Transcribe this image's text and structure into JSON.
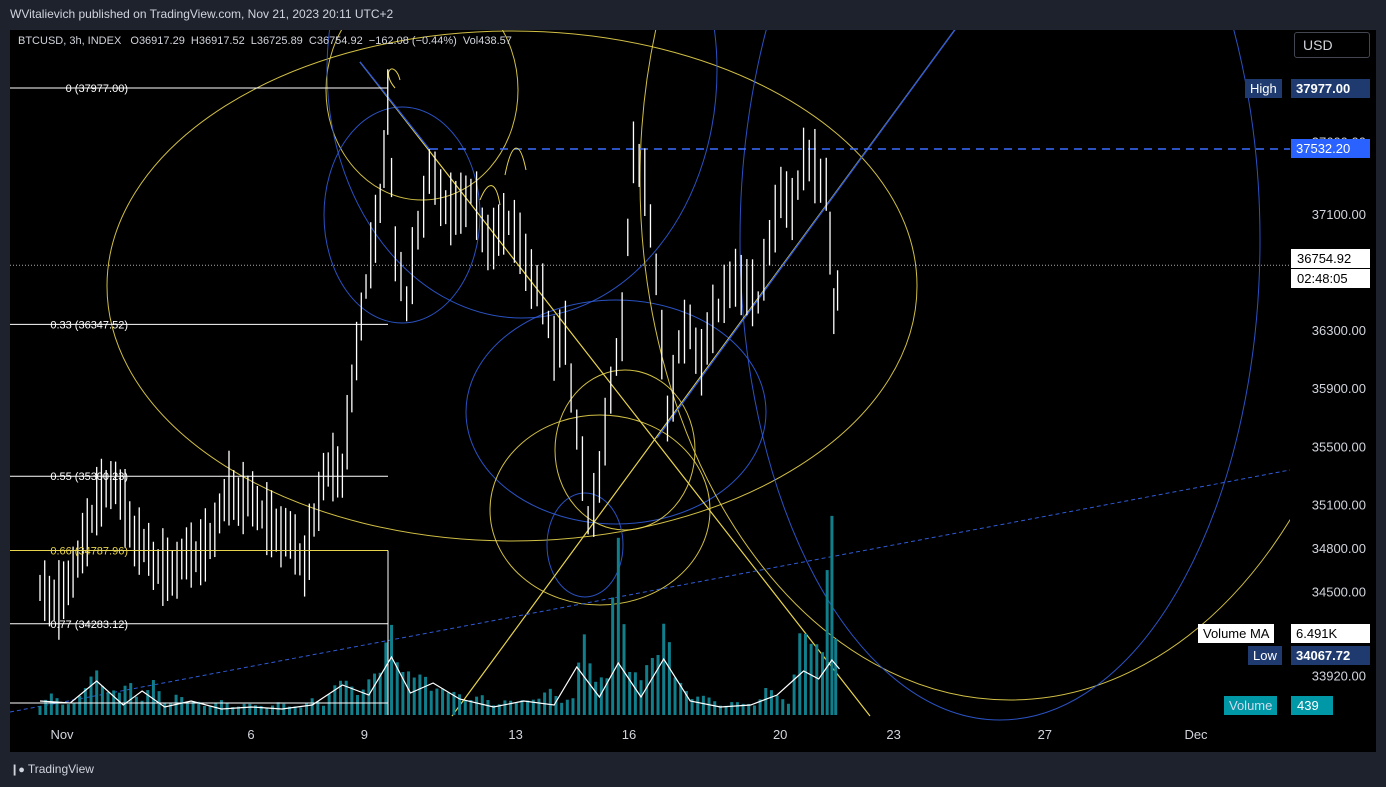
{
  "header": {
    "publisher": "WVitalievich published on TradingView.com, Nov 21, 2023 20:11 UTC+2",
    "currency_button": "USD",
    "brand": "TradingView"
  },
  "legend": {
    "symbol": "BTCUSD, 3h, INDEX",
    "open_label": "O",
    "open": "36917.29",
    "high_label": "H",
    "high": "36917.52",
    "low_label": "L",
    "low": "36725.89",
    "close_label": "C",
    "close": "36754.92",
    "change": "−162.08 (−0.44%)",
    "vol_label": "Vol",
    "vol": "438.57"
  },
  "price_badges": {
    "high_label": "High",
    "high_value": "37977.00",
    "level_value": "37532.20",
    "last_price": "36754.92",
    "countdown": "02:48:05",
    "vma_label": "Volume MA",
    "vma_value": "6.491K",
    "low_label": "Low",
    "low_value": "34067.72",
    "volume_label": "Volume",
    "volume_value": "439"
  },
  "colors": {
    "background": "#000000",
    "candle": "#ffffff",
    "fib_yellow": "#e8d44d",
    "fib_blue": "#2f5bd6",
    "volume": "#117e8c",
    "level_line": "#3b6cff"
  },
  "chart_data": {
    "type": "bar",
    "title": "",
    "xlabel": "",
    "ylabel": "",
    "ylim": [
      33700,
      38650
    ],
    "x_ticks": [
      {
        "label": "Nov",
        "day": 0
      },
      {
        "label": "6",
        "day": 5
      },
      {
        "label": "9",
        "day": 8
      },
      {
        "label": "13",
        "day": 12
      },
      {
        "label": "16",
        "day": 15
      },
      {
        "label": "20",
        "day": 19
      },
      {
        "label": "23",
        "day": 22
      },
      {
        "label": "27",
        "day": 26
      },
      {
        "label": "Dec",
        "day": 30
      }
    ],
    "y_ticks": [
      {
        "label": "37600.00",
        "value": 37600
      },
      {
        "label": "37100.00",
        "value": 37100
      },
      {
        "label": "36300.00",
        "value": 36300
      },
      {
        "label": "35900.00",
        "value": 35900
      },
      {
        "label": "35500.00",
        "value": 35500
      },
      {
        "label": "35100.00",
        "value": 35100
      },
      {
        "label": "34800.00",
        "value": 34800
      },
      {
        "label": "34500.00",
        "value": 34500
      },
      {
        "label": "33920.00",
        "value": 33920
      }
    ],
    "fib_levels": [
      {
        "label": "0 (37977.00)",
        "value": 37977
      },
      {
        "label": "0.33 (36347.52)",
        "value": 36347.52
      },
      {
        "label": "0.55 (35300.23)",
        "value": 35300.23
      },
      {
        "label": "0.66 (34787.96)",
        "value": 34787.96,
        "highlight": true
      },
      {
        "label": "0.77 (34283.12)",
        "value": 34283.12
      }
    ],
    "horizontal_level": 37532.2,
    "last_price": 36754.92,
    "price_path": [
      [
        0.0,
        34500
      ],
      [
        0.5,
        34450
      ],
      [
        1.0,
        34700
      ],
      [
        1.5,
        35150
      ],
      [
        2.0,
        35250
      ],
      [
        2.5,
        34900
      ],
      [
        3.0,
        34700
      ],
      [
        3.5,
        34650
      ],
      [
        4.0,
        34750
      ],
      [
        4.5,
        34850
      ],
      [
        5.0,
        35200
      ],
      [
        5.5,
        35150
      ],
      [
        6.0,
        35000
      ],
      [
        6.5,
        34900
      ],
      [
        7.0,
        34700
      ],
      [
        7.5,
        35300
      ],
      [
        8.0,
        35350
      ],
      [
        8.25,
        35900
      ],
      [
        8.5,
        36400
      ],
      [
        8.75,
        36800
      ],
      [
        9.0,
        37200
      ],
      [
        9.2,
        37900
      ],
      [
        9.4,
        36800
      ],
      [
        9.7,
        36500
      ],
      [
        10.0,
        37000
      ],
      [
        10.3,
        37400
      ],
      [
        10.6,
        37200
      ],
      [
        11.0,
        37150
      ],
      [
        11.4,
        37250
      ],
      [
        11.7,
        37000
      ],
      [
        12.0,
        36950
      ],
      [
        12.4,
        37050
      ],
      [
        12.7,
        36900
      ],
      [
        13.0,
        36700
      ],
      [
        13.3,
        36500
      ],
      [
        13.6,
        36200
      ],
      [
        13.9,
        36300
      ],
      [
        14.2,
        35600
      ],
      [
        14.5,
        35000
      ],
      [
        14.8,
        35300
      ],
      [
        15.1,
        35900
      ],
      [
        15.4,
        36300
      ],
      [
        15.7,
        37600
      ],
      [
        16.0,
        37300
      ],
      [
        16.3,
        36700
      ],
      [
        16.6,
        35700
      ],
      [
        16.9,
        36200
      ],
      [
        17.2,
        36300
      ],
      [
        17.5,
        36100
      ],
      [
        17.8,
        36400
      ],
      [
        18.1,
        36500
      ],
      [
        18.4,
        36700
      ],
      [
        18.7,
        36600
      ],
      [
        19.0,
        36500
      ],
      [
        19.3,
        36900
      ],
      [
        19.6,
        37300
      ],
      [
        19.9,
        37100
      ],
      [
        20.2,
        37500
      ],
      [
        20.5,
        37450
      ],
      [
        20.8,
        37300
      ],
      [
        21.0,
        36400
      ],
      [
        21.2,
        36750
      ]
    ],
    "volume": {
      "series": [
        [
          0.0,
          12
        ],
        [
          0.3,
          18
        ],
        [
          0.6,
          9
        ],
        [
          0.9,
          14
        ],
        [
          1.2,
          22
        ],
        [
          1.5,
          40
        ],
        [
          1.8,
          26
        ],
        [
          2.1,
          18
        ],
        [
          2.4,
          30
        ],
        [
          2.7,
          15
        ],
        [
          3.0,
          28
        ],
        [
          3.3,
          12
        ],
        [
          3.6,
          20
        ],
        [
          3.9,
          10
        ],
        [
          4.2,
          14
        ],
        [
          4.5,
          8
        ],
        [
          4.8,
          12
        ],
        [
          5.1,
          9
        ],
        [
          5.4,
          10
        ],
        [
          5.7,
          8
        ],
        [
          6.0,
          9
        ],
        [
          6.3,
          11
        ],
        [
          6.6,
          7
        ],
        [
          6.9,
          10
        ],
        [
          7.2,
          14
        ],
        [
          7.5,
          8
        ],
        [
          7.8,
          36
        ],
        [
          8.1,
          28
        ],
        [
          8.4,
          18
        ],
        [
          8.7,
          40
        ],
        [
          9.0,
          34
        ],
        [
          9.3,
          85
        ],
        [
          9.6,
          45
        ],
        [
          9.9,
          30
        ],
        [
          10.2,
          38
        ],
        [
          10.5,
          26
        ],
        [
          10.8,
          18
        ],
        [
          11.1,
          22
        ],
        [
          11.4,
          14
        ],
        [
          11.7,
          16
        ],
        [
          12.0,
          11
        ],
        [
          12.3,
          13
        ],
        [
          12.6,
          10
        ],
        [
          12.9,
          18
        ],
        [
          13.2,
          14
        ],
        [
          13.5,
          22
        ],
        [
          13.8,
          16
        ],
        [
          14.1,
          14
        ],
        [
          14.4,
          70
        ],
        [
          14.7,
          40
        ],
        [
          15.0,
          30
        ],
        [
          15.3,
          160
        ],
        [
          15.6,
          48
        ],
        [
          15.9,
          28
        ],
        [
          16.2,
          54
        ],
        [
          16.5,
          95
        ],
        [
          16.8,
          30
        ],
        [
          17.1,
          24
        ],
        [
          17.4,
          18
        ],
        [
          17.7,
          14
        ],
        [
          18.0,
          10
        ],
        [
          18.3,
          12
        ],
        [
          18.6,
          9
        ],
        [
          18.9,
          11
        ],
        [
          19.2,
          24
        ],
        [
          19.5,
          16
        ],
        [
          19.8,
          14
        ],
        [
          20.1,
          70
        ],
        [
          20.4,
          60
        ],
        [
          20.7,
          82
        ],
        [
          20.95,
          165
        ],
        [
          21.15,
          8
        ]
      ],
      "ma": [
        [
          0.0,
          14
        ],
        [
          0.8,
          12
        ],
        [
          1.5,
          34
        ],
        [
          2.2,
          10
        ],
        [
          2.7,
          24
        ],
        [
          3.3,
          8
        ],
        [
          4.0,
          14
        ],
        [
          4.8,
          6
        ],
        [
          5.6,
          8
        ],
        [
          6.4,
          6
        ],
        [
          7.2,
          10
        ],
        [
          8.0,
          30
        ],
        [
          8.7,
          20
        ],
        [
          9.3,
          58
        ],
        [
          9.8,
          22
        ],
        [
          10.4,
          32
        ],
        [
          11.1,
          16
        ],
        [
          12.0,
          8
        ],
        [
          12.8,
          14
        ],
        [
          13.6,
          10
        ],
        [
          14.2,
          48
        ],
        [
          14.8,
          18
        ],
        [
          15.3,
          52
        ],
        [
          15.9,
          18
        ],
        [
          16.5,
          56
        ],
        [
          17.2,
          14
        ],
        [
          18.0,
          8
        ],
        [
          18.8,
          10
        ],
        [
          19.5,
          20
        ],
        [
          20.2,
          44
        ],
        [
          20.6,
          36
        ],
        [
          20.95,
          55
        ],
        [
          21.15,
          46
        ]
      ]
    }
  }
}
